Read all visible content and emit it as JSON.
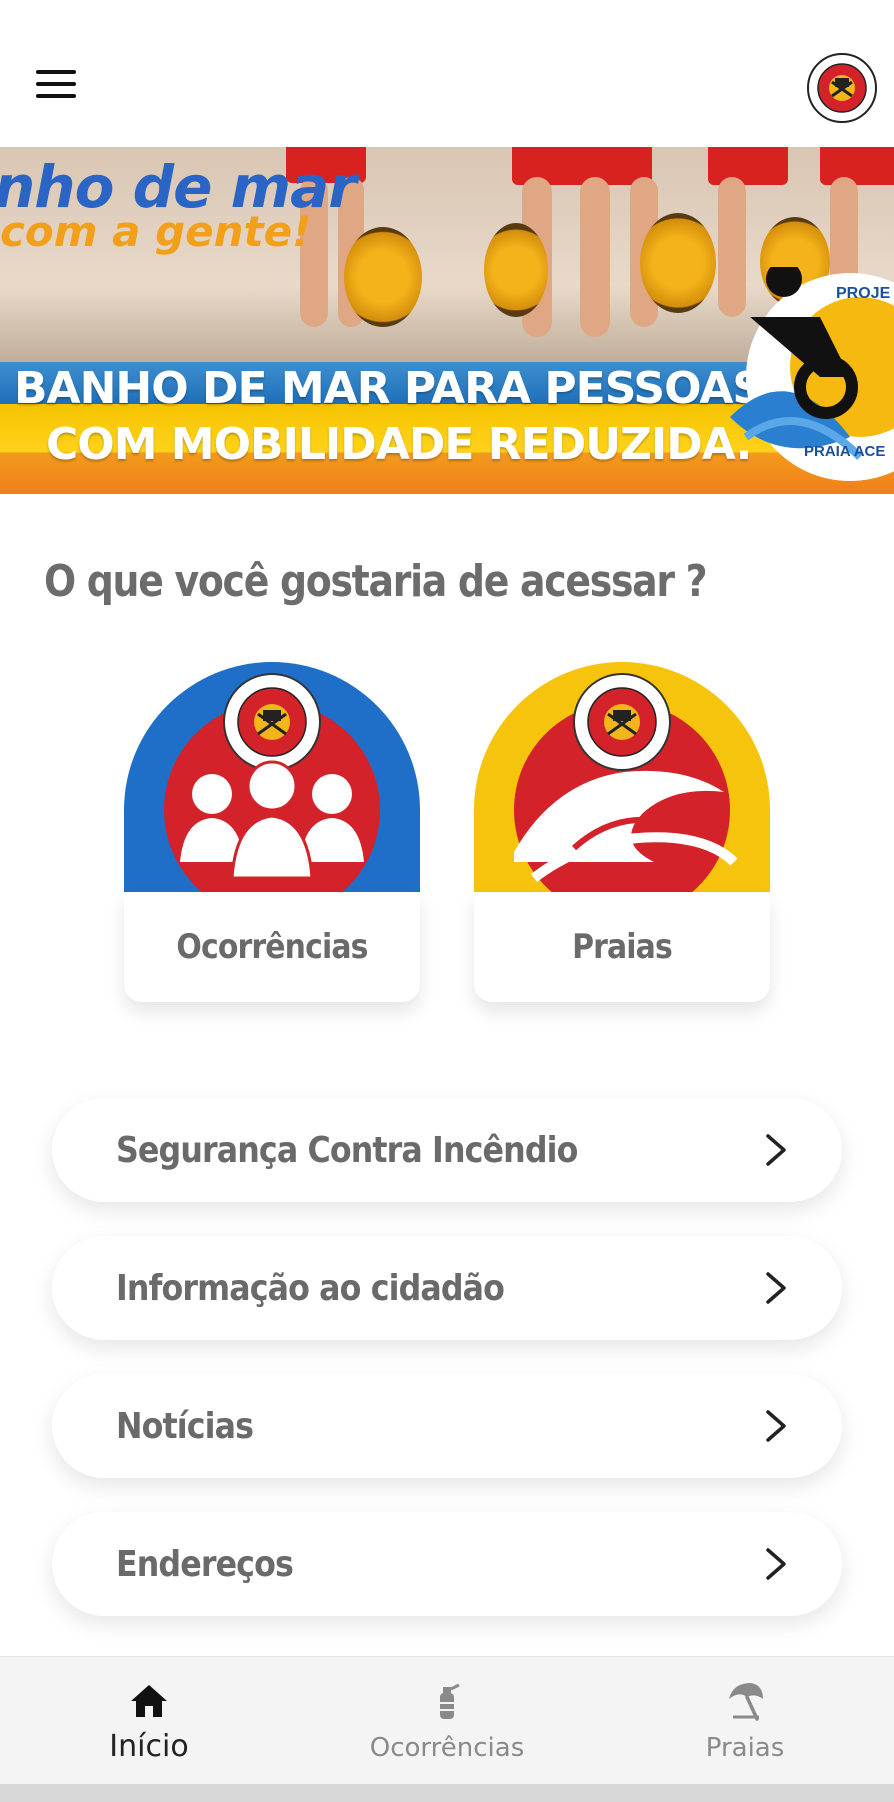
{
  "header": {
    "menu_icon": "hamburger-menu-icon",
    "logo_icon": "corpo-de-bombeiros-militar-santa-catarina-logo"
  },
  "banner": {
    "title_line1": "nho de mar",
    "title_line2": "com a gente!",
    "line1": "BANHO DE MAR PARA PESSOAS",
    "line2": "COM MOBILIDADE REDUZIDA.",
    "badge_top": "PROJE",
    "badge_bottom": "PRAIA ACE"
  },
  "question": "O que você gostaria de acessar ?",
  "cards": [
    {
      "label": "Ocorrências",
      "ring_color": "#1f6fc8",
      "icon": "people-silhouette-icon"
    },
    {
      "label": "Praias",
      "ring_color": "#f6c30d",
      "icon": "wave-icon"
    }
  ],
  "list": [
    {
      "label": "Segurança Contra Incêndio"
    },
    {
      "label": "Informação ao cidadão"
    },
    {
      "label": "Notícias"
    },
    {
      "label": "Endereços"
    }
  ],
  "bottom_nav": [
    {
      "label": "Início",
      "icon": "home-icon",
      "active": true
    },
    {
      "label": "Ocorrências",
      "icon": "fire-extinguisher-icon",
      "active": false
    },
    {
      "label": "Praias",
      "icon": "beach-umbrella-icon",
      "active": false
    }
  ],
  "colors": {
    "brand_red": "#d3222a",
    "blue": "#1f6fc8",
    "yellow": "#f6c30d",
    "text_gray": "#6a6a6a"
  }
}
